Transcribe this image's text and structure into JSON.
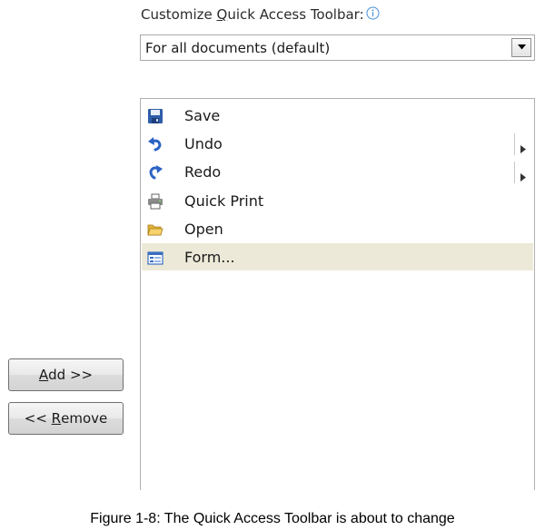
{
  "customize": {
    "label_before": "Customize ",
    "label_underlined": "Q",
    "label_after": "uick Access Toolbar:",
    "info_icon": "info-icon"
  },
  "scope_select": {
    "value": "For all documents (default)",
    "arrow_icon": "dropdown-arrow-icon"
  },
  "qat_items": [
    {
      "label": "Save",
      "icon": "save-icon",
      "submenu": false
    },
    {
      "label": "Undo",
      "icon": "undo-icon",
      "submenu": true
    },
    {
      "label": "Redo",
      "icon": "redo-icon",
      "submenu": true
    },
    {
      "label": "Quick Print",
      "icon": "quick-print-icon",
      "submenu": false
    },
    {
      "label": "Open",
      "icon": "open-folder-icon",
      "submenu": false
    },
    {
      "label": "Form...",
      "icon": "form-icon",
      "submenu": false,
      "selected": true
    }
  ],
  "buttons": {
    "add": {
      "underlined": "A",
      "rest": "dd >>"
    },
    "remove": {
      "prefix": "<< ",
      "underlined": "R",
      "rest": "emove"
    }
  },
  "caption": "Figure 1-8: The Quick Access Toolbar is about to change",
  "colors": {
    "selected_row": "#ece9d8",
    "info_icon": "#4a90d9",
    "list_border": "#b0b0b0"
  }
}
